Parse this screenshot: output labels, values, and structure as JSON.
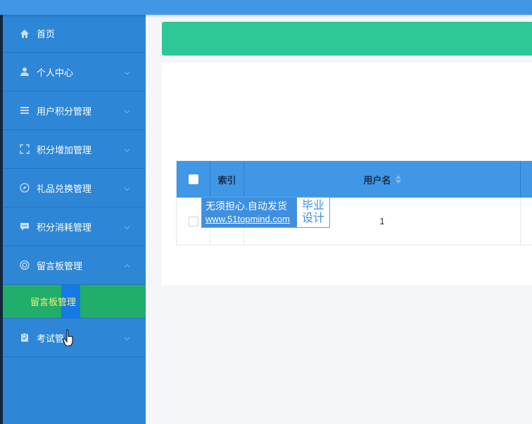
{
  "sidebar": {
    "items": [
      {
        "label": "首页",
        "icon": "home-icon"
      },
      {
        "label": "个人中心",
        "icon": "user-icon"
      },
      {
        "label": "用户积分管理",
        "icon": "list-icon"
      },
      {
        "label": "积分增加管理",
        "icon": "fullscreen-icon"
      },
      {
        "label": "礼品兑换管理",
        "icon": "compass-icon"
      },
      {
        "label": "积分消耗管理",
        "icon": "message-icon"
      },
      {
        "label": "留言板管理",
        "icon": "help-icon"
      },
      {
        "label": "考试管",
        "icon": "clipboard-icon"
      }
    ],
    "submenu": {
      "label": "留言板管理"
    }
  },
  "table": {
    "headers": {
      "index": "索引",
      "username": "用户名"
    },
    "rows": [
      {
        "index": "",
        "username": "1"
      }
    ]
  },
  "watermark": {
    "line1": "无须担心.自动发货",
    "line2": "www.51topmind.com",
    "right1": "毕业",
    "right2": "设计"
  },
  "colors": {
    "topbar": "#3f97e6",
    "sidebar": "#2e86d6",
    "active_submenu": "#21ad6a",
    "green_bar": "#2ec897",
    "table_header": "#3f97e6"
  }
}
